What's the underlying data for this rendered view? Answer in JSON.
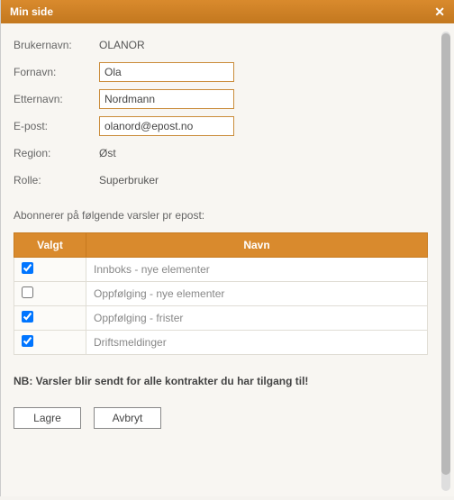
{
  "window": {
    "title": "Min side"
  },
  "form": {
    "labels": {
      "username": "Brukernavn:",
      "firstname": "Fornavn:",
      "lastname": "Etternavn:",
      "email": "E-post:",
      "region": "Region:",
      "role": "Rolle:"
    },
    "values": {
      "username": "OLANOR",
      "firstname": "Ola",
      "lastname": "Nordmann",
      "email": "olanord@epost.no",
      "region": "Øst",
      "role": "Superbruker"
    }
  },
  "subscriptions": {
    "heading": "Abonnerer på følgende varsler pr epost:",
    "columns": {
      "selected": "Valgt",
      "name": "Navn"
    },
    "items": [
      {
        "name": "Innboks - nye elementer",
        "checked": true
      },
      {
        "name": "Oppfølging - nye elementer",
        "checked": false
      },
      {
        "name": "Oppfølging - frister",
        "checked": true
      },
      {
        "name": "Driftsmeldinger",
        "checked": true
      }
    ]
  },
  "warning": "NB: Varsler blir sendt for alle kontrakter du har tilgang til!",
  "buttons": {
    "save": "Lagre",
    "cancel": "Avbryt"
  }
}
